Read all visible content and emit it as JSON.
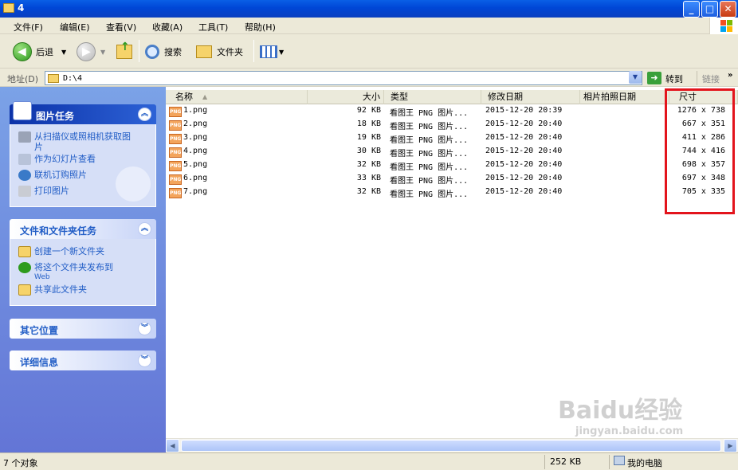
{
  "window": {
    "title": "4"
  },
  "menu": [
    "文件(F)",
    "编辑(E)",
    "查看(V)",
    "收藏(A)",
    "工具(T)",
    "帮助(H)"
  ],
  "toolbar": {
    "back": "后退",
    "search": "搜索",
    "folders": "文件夹"
  },
  "address": {
    "label": "地址(D)",
    "path": "D:\\4",
    "go": "转到",
    "links": "链接"
  },
  "sidebar": {
    "picture_tasks": {
      "title": "图片任务",
      "items": [
        "从扫描仪或照相机获取图片",
        "作为幻灯片查看",
        "联机订购照片",
        "打印图片"
      ]
    },
    "file_tasks": {
      "title": "文件和文件夹任务",
      "items": [
        "创建一个新文件夹",
        "将这个文件夹发布到",
        "Web",
        "共享此文件夹"
      ]
    },
    "other_places": {
      "title": "其它位置"
    },
    "details": {
      "title": "详细信息"
    }
  },
  "columns": {
    "name": "名称",
    "size": "大小",
    "type": "类型",
    "modified": "修改日期",
    "taken": "相片拍照日期",
    "dimensions": "尺寸"
  },
  "files": [
    {
      "name": "1.png",
      "size": "92 KB",
      "type": "看图王 PNG 图片...",
      "modified": "2015-12-20 20:39",
      "dimensions": "1276 x 738"
    },
    {
      "name": "2.png",
      "size": "18 KB",
      "type": "看图王 PNG 图片...",
      "modified": "2015-12-20 20:40",
      "dimensions": "667 x 351"
    },
    {
      "name": "3.png",
      "size": "19 KB",
      "type": "看图王 PNG 图片...",
      "modified": "2015-12-20 20:40",
      "dimensions": "411 x 286"
    },
    {
      "name": "4.png",
      "size": "30 KB",
      "type": "看图王 PNG 图片...",
      "modified": "2015-12-20 20:40",
      "dimensions": "744 x 416"
    },
    {
      "name": "5.png",
      "size": "32 KB",
      "type": "看图王 PNG 图片...",
      "modified": "2015-12-20 20:40",
      "dimensions": "698 x 357"
    },
    {
      "name": "6.png",
      "size": "33 KB",
      "type": "看图王 PNG 图片...",
      "modified": "2015-12-20 20:40",
      "dimensions": "697 x 348"
    },
    {
      "name": "7.png",
      "size": "32 KB",
      "type": "看图王 PNG 图片...",
      "modified": "2015-12-20 20:40",
      "dimensions": "705 x 335"
    }
  ],
  "file_icon_text": "PNG",
  "status": {
    "objects": "7 个对象",
    "size": "252 KB",
    "location": "我的电脑"
  },
  "watermark": "Baidu经验",
  "watermark_url": "jingyan.baidu.com",
  "colors": {
    "title_bar": "#0046D6",
    "task_pane": "#6375D6",
    "highlight_box": "#E3141C"
  }
}
